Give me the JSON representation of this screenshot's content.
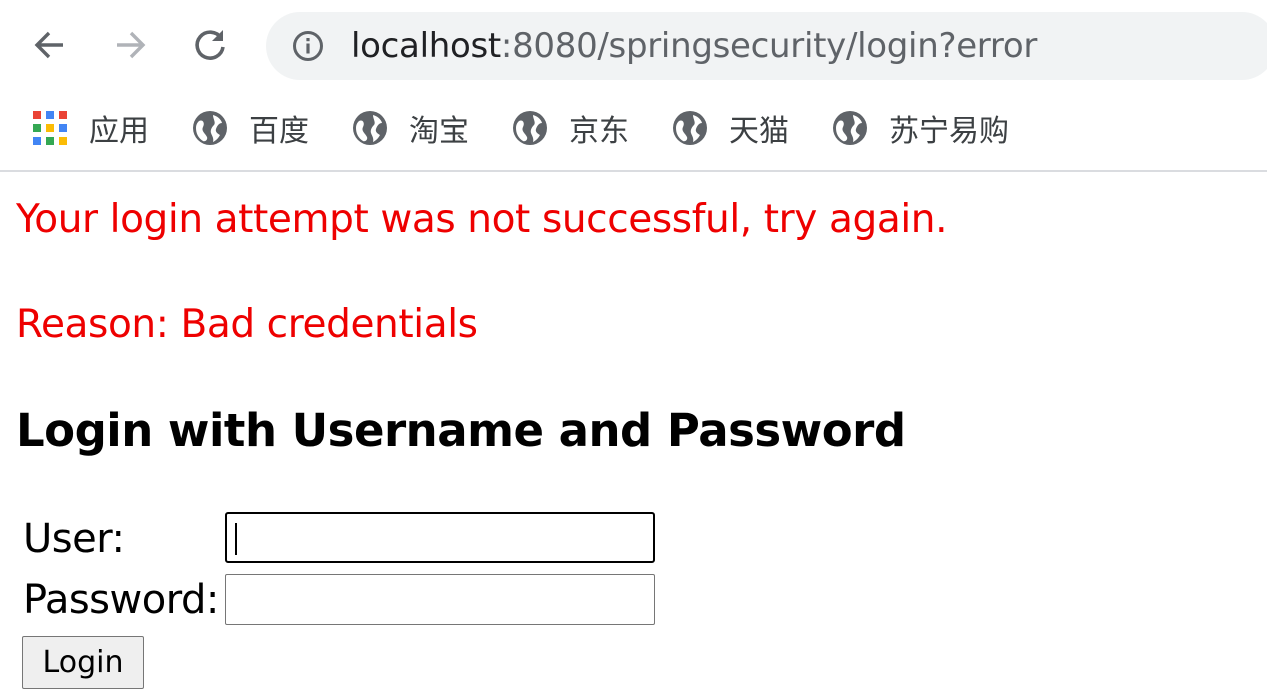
{
  "browser": {
    "url_host": "localhost",
    "url_path": ":8080/springsecurity/login?error",
    "bookmarks": [
      {
        "label": "应用",
        "icon": "apps-grid-icon"
      },
      {
        "label": "百度",
        "icon": "globe-icon"
      },
      {
        "label": "淘宝",
        "icon": "globe-icon"
      },
      {
        "label": "京东",
        "icon": "globe-icon"
      },
      {
        "label": "天猫",
        "icon": "globe-icon"
      },
      {
        "label": "苏宁易购",
        "icon": "globe-icon"
      }
    ]
  },
  "page": {
    "error_message": "Your login attempt was not successful, try again.",
    "error_reason": "Reason: Bad credentials",
    "heading": "Login with Username and Password",
    "user_label": "User:",
    "password_label": "Password:",
    "user_value": "",
    "password_value": "",
    "login_button": "Login"
  },
  "colors": {
    "error_text": "#ee0000",
    "omnibox_bg": "#f1f3f4",
    "icon_gray": "#5f6368"
  }
}
